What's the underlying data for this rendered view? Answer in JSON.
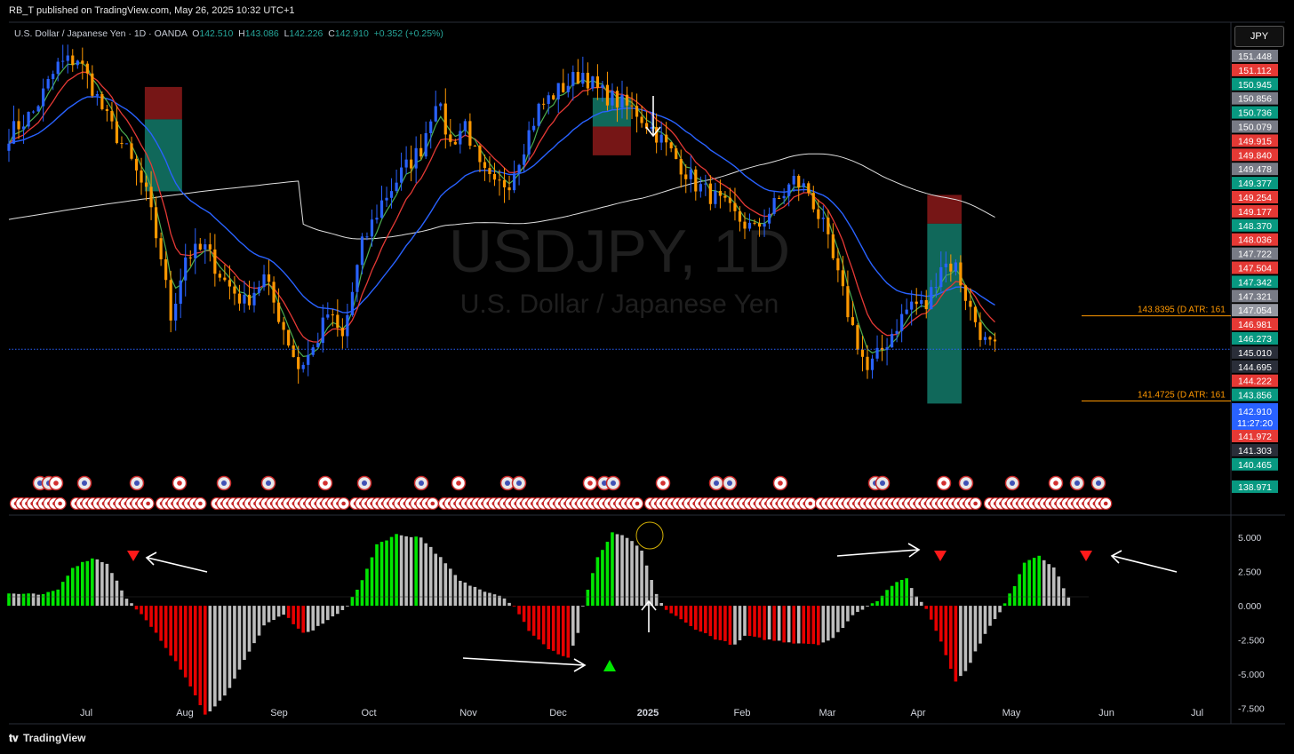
{
  "header": {
    "published": "RB_T published on TradingView.com, May 26, 2025 10:32 UTC+1"
  },
  "legend": {
    "symbol": "U.S. Dollar / Japanese Yen · 1D · OANDA",
    "o_label": "O",
    "o": "142.510",
    "h_label": "H",
    "h": "143.086",
    "l_label": "L",
    "l": "142.226",
    "c_label": "C",
    "c": "142.910",
    "change": "+0.352 (+0.25%)"
  },
  "watermark": {
    "ticker": "USDJPY, 1D",
    "name": "U.S. Dollar / Japanese Yen"
  },
  "currency_button": "JPY",
  "footer": {
    "brand": "TradingView"
  },
  "colors": {
    "bull": "#26a69a",
    "bear": "#ef5350",
    "candle_up": "#2962ff",
    "candle_down": "#ff9800",
    "ema_fast": "#4caf50",
    "ema_mid": "#e53935",
    "ema_slow": "#2962ff",
    "sma_long": "#e0e0e0",
    "hist_green": "#00e600",
    "hist_red": "#e60000",
    "hist_grey": "#bdbdbd"
  },
  "chart_data": [
    {
      "type": "candlestick",
      "title": "USDJPY, 1D",
      "x_labels": [
        "Jul",
        "Aug",
        "Sep",
        "Oct",
        "Nov",
        "Dec",
        "2025",
        "Feb",
        "Mar",
        "Apr",
        "May",
        "Jun",
        "Jul"
      ],
      "ylim": [
        138.3,
        152.0
      ],
      "last_price": "142.910",
      "countdown": "11:27:20",
      "price_scale_labels": [
        {
          "v": "151.448",
          "c": "#787b86"
        },
        {
          "v": "151.112",
          "c": "#e53935"
        },
        {
          "v": "150.945",
          "c": "#089981"
        },
        {
          "v": "150.856",
          "c": "#787b86"
        },
        {
          "v": "150.736",
          "c": "#089981"
        },
        {
          "v": "150.079",
          "c": "#787b86"
        },
        {
          "v": "149.915",
          "c": "#e53935"
        },
        {
          "v": "149.840",
          "c": "#e53935"
        },
        {
          "v": "149.478",
          "c": "#787b86"
        },
        {
          "v": "149.377",
          "c": "#089981"
        },
        {
          "v": "149.254",
          "c": "#e53935"
        },
        {
          "v": "149.177",
          "c": "#e53935"
        },
        {
          "v": "148.370",
          "c": "#089981"
        },
        {
          "v": "148.036",
          "c": "#e53935"
        },
        {
          "v": "147.722",
          "c": "#787b86"
        },
        {
          "v": "147.504",
          "c": "#e53935"
        },
        {
          "v": "147.342",
          "c": "#089981"
        },
        {
          "v": "147.321",
          "c": "#787b86"
        },
        {
          "v": "147.054",
          "c": "#9598a1"
        },
        {
          "v": "146.981",
          "c": "#e53935"
        },
        {
          "v": "146.273",
          "c": "#089981"
        },
        {
          "v": "145.010",
          "c": "#2a2e39"
        },
        {
          "v": "144.695",
          "c": "#2a2e39"
        },
        {
          "v": "144.222",
          "c": "#e53935"
        },
        {
          "v": "143.856",
          "c": "#089981"
        },
        {
          "v": "141.972",
          "c": "#e53935"
        },
        {
          "v": "141.303",
          "c": "#2a2e39"
        },
        {
          "v": "140.465",
          "c": "#089981"
        },
        {
          "v": "138.971",
          "c": "#089981"
        }
      ],
      "atr_lines": [
        {
          "price": 143.8395,
          "label": "143.8395 (D ATR: 161"
        },
        {
          "price": 141.4725,
          "label": "141.4725 (D ATR: 161"
        }
      ],
      "close_path": [
        [
          0,
          148.9
        ],
        [
          5,
          149.5
        ],
        [
          10,
          150.8
        ],
        [
          14,
          151.0
        ],
        [
          17,
          150.2
        ],
        [
          20,
          149.3
        ],
        [
          24,
          148.4
        ],
        [
          28,
          147.2
        ],
        [
          31,
          145.5
        ],
        [
          33,
          143.8
        ],
        [
          36,
          145.5
        ],
        [
          40,
          145.7
        ],
        [
          44,
          144.8
        ],
        [
          48,
          144.2
        ],
        [
          52,
          144.9
        ],
        [
          56,
          143.5
        ],
        [
          59,
          142.4
        ],
        [
          62,
          142.9
        ],
        [
          65,
          143.9
        ],
        [
          68,
          143.2
        ],
        [
          72,
          145.8
        ],
        [
          76,
          147.0
        ],
        [
          80,
          147.8
        ],
        [
          84,
          148.5
        ],
        [
          87,
          149.9
        ],
        [
          90,
          148.6
        ],
        [
          93,
          149.2
        ],
        [
          96,
          147.9
        ],
        [
          99,
          147.4
        ],
        [
          102,
          147.6
        ],
        [
          105,
          148.6
        ],
        [
          108,
          149.6
        ],
        [
          111,
          150.0
        ],
        [
          114,
          150.3
        ],
        [
          117,
          150.6
        ],
        [
          120,
          150.1
        ],
        [
          124,
          149.8
        ],
        [
          128,
          149.5
        ],
        [
          132,
          148.9
        ],
        [
          136,
          148.2
        ],
        [
          140,
          147.5
        ],
        [
          144,
          147.1
        ],
        [
          148,
          146.6
        ],
        [
          152,
          146.2
        ],
        [
          156,
          146.9
        ],
        [
          160,
          147.6
        ],
        [
          163,
          147.3
        ],
        [
          166,
          146.3
        ],
        [
          169,
          144.9
        ],
        [
          172,
          143.5
        ],
        [
          175,
          142.3
        ],
        [
          178,
          142.9
        ],
        [
          181,
          143.6
        ],
        [
          184,
          144.2
        ],
        [
          187,
          144.1
        ],
        [
          190,
          145.3
        ],
        [
          193,
          145.2
        ],
        [
          196,
          144.0
        ],
        [
          199,
          143.1
        ],
        [
          201,
          142.9
        ]
      ],
      "position_boxes": [
        {
          "start": 27.7,
          "end": 35.3,
          "entry": 149.3,
          "stop": 150.2,
          "target": 147.3
        },
        {
          "start": 119.0,
          "end": 126.8,
          "entry": 149.1,
          "stop": 148.3,
          "target": 149.9
        },
        {
          "start": 187.2,
          "end": 194.2,
          "entry": 146.4,
          "stop": 147.2,
          "target": 141.4
        }
      ]
    },
    {
      "type": "bar",
      "title": "",
      "y_ticks": [
        "5.000",
        "2.500",
        "0.000",
        "-2.500",
        "-5.000",
        "-7.500"
      ],
      "ylim": [
        -8.5,
        6.5
      ],
      "key_points": [
        [
          0,
          0.9
        ],
        [
          7,
          0.8
        ],
        [
          10,
          1.2
        ],
        [
          13,
          2.8
        ],
        [
          17,
          3.5
        ],
        [
          20,
          3.1
        ],
        [
          24,
          0.5
        ],
        [
          26,
          -0.2
        ],
        [
          31,
          -2.5
        ],
        [
          36,
          -5.2
        ],
        [
          40,
          -8.0
        ],
        [
          44,
          -6.6
        ],
        [
          48,
          -4.0
        ],
        [
          52,
          -1.5
        ],
        [
          56,
          -0.6
        ],
        [
          60,
          -2.0
        ],
        [
          62,
          -1.8
        ],
        [
          66,
          -0.8
        ],
        [
          69,
          0.0
        ],
        [
          72,
          1.8
        ],
        [
          75,
          4.5
        ],
        [
          79,
          5.2
        ],
        [
          84,
          5.0
        ],
        [
          88,
          3.5
        ],
        [
          92,
          1.8
        ],
        [
          96,
          1.2
        ],
        [
          100,
          0.8
        ],
        [
          103,
          0.0
        ],
        [
          106,
          -1.8
        ],
        [
          110,
          -3.2
        ],
        [
          114,
          -3.8
        ],
        [
          116,
          -2.0
        ],
        [
          117,
          0.0
        ],
        [
          120,
          3.5
        ],
        [
          123,
          5.3
        ],
        [
          126,
          5.0
        ],
        [
          129,
          4.0
        ],
        [
          132,
          0.8
        ],
        [
          134,
          -0.3
        ],
        [
          139,
          -1.5
        ],
        [
          144,
          -2.4
        ],
        [
          148,
          -2.9
        ],
        [
          150,
          -2.2
        ],
        [
          155,
          -2.5
        ],
        [
          160,
          -2.7
        ],
        [
          165,
          -2.8
        ],
        [
          168,
          -2.4
        ],
        [
          172,
          -0.7
        ],
        [
          175,
          0.0
        ],
        [
          177,
          0.4
        ],
        [
          180,
          1.5
        ],
        [
          183,
          2.0
        ],
        [
          185,
          0.7
        ],
        [
          187,
          -0.2
        ],
        [
          190,
          -2.6
        ],
        [
          193,
          -5.5
        ],
        [
          195,
          -4.8
        ],
        [
          199,
          -2.0
        ],
        [
          202,
          -0.5
        ],
        [
          205,
          1.5
        ],
        [
          207,
          3.2
        ],
        [
          210,
          3.7
        ],
        [
          213,
          2.8
        ],
        [
          216,
          0.6
        ]
      ]
    }
  ]
}
